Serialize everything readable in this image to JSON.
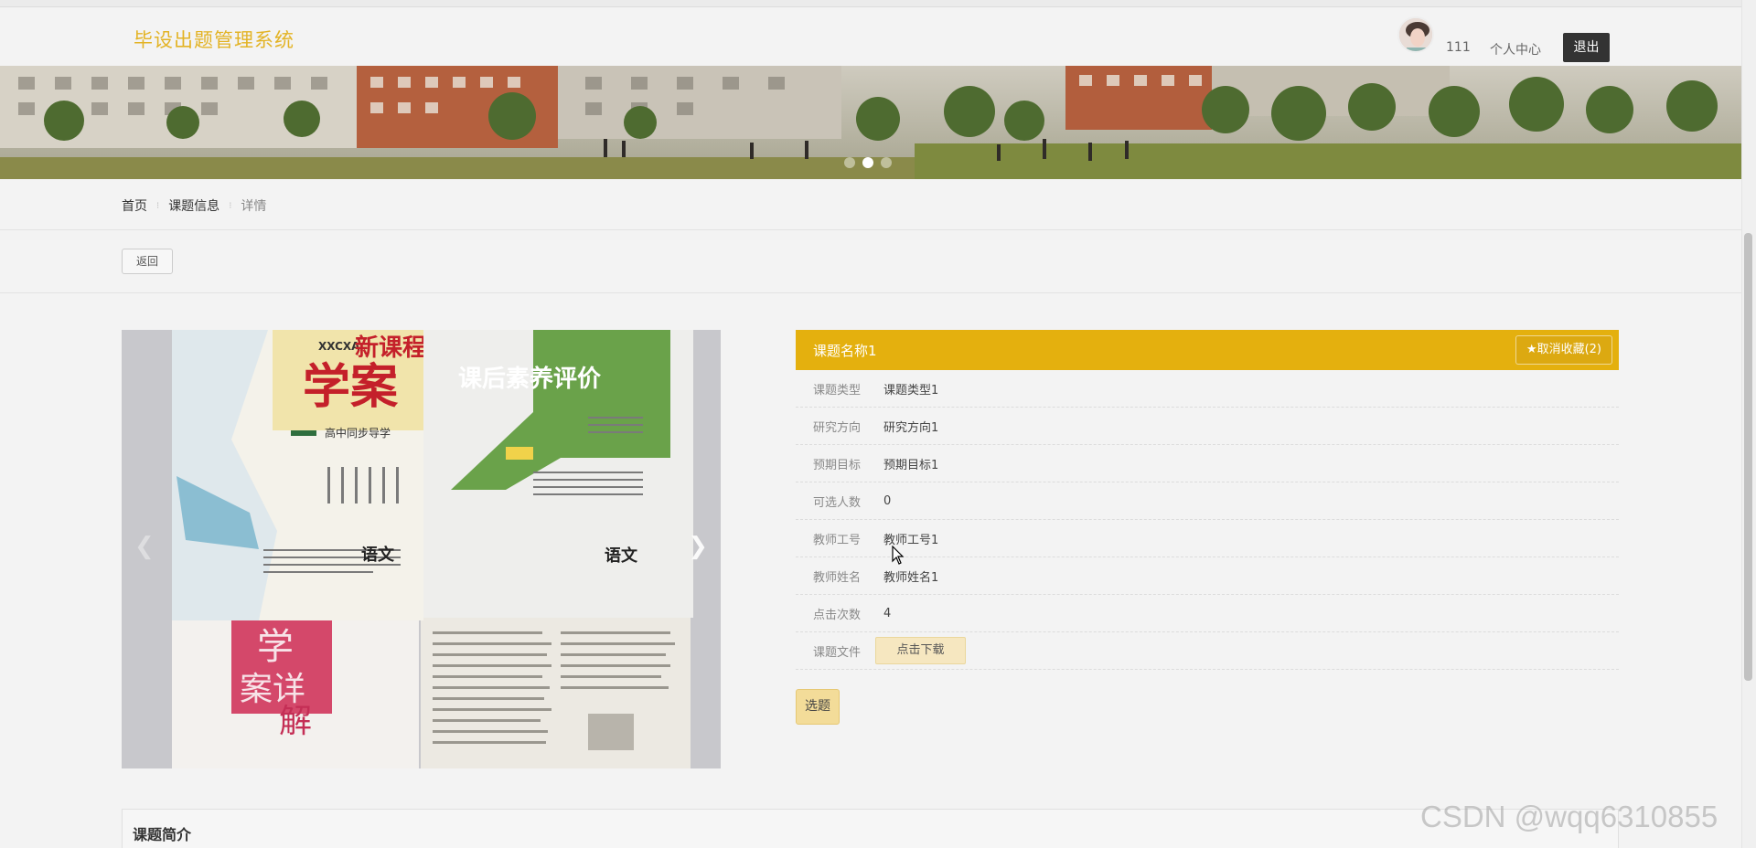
{
  "header": {
    "site_title": "毕设出题管理系统",
    "username": "111",
    "user_center": "个人中心",
    "logout": "退出"
  },
  "banner": {
    "slides": 3,
    "active_slide": 2
  },
  "breadcrumb": {
    "home": "首页",
    "section": "课题信息",
    "current": "详情"
  },
  "actions": {
    "back": "返回"
  },
  "carousel": {
    "book1_series": "XXCXA",
    "book1_title_a": "新课程",
    "book1_title_b": "学案",
    "book1_subtitle": "高中同步导学",
    "book1_subject": "语文",
    "book2_title": "课后素养评价",
    "book2_subject": "语文",
    "book3_title_a": "学",
    "book3_title_b": "案详",
    "book3_title_c": "解"
  },
  "detail": {
    "title": "课题名称1",
    "favorite_button": "★取消收藏(2)",
    "fields": [
      {
        "label": "课题类型",
        "value": "课题类型1"
      },
      {
        "label": "研究方向",
        "value": "研究方向1"
      },
      {
        "label": "预期目标",
        "value": "预期目标1"
      },
      {
        "label": "可选人数",
        "value": "0"
      },
      {
        "label": "教师工号",
        "value": "教师工号1"
      },
      {
        "label": "教师姓名",
        "value": "教师姓名1"
      },
      {
        "label": "点击次数",
        "value": "4"
      }
    ],
    "file_label": "课题文件",
    "download_button": "点击下载",
    "select_button": "选题"
  },
  "intro": {
    "title": "课题简介"
  },
  "watermark": "CSDN @wqq6310855",
  "colors": {
    "accent": "#e4b00e",
    "title": "#e3b324"
  }
}
